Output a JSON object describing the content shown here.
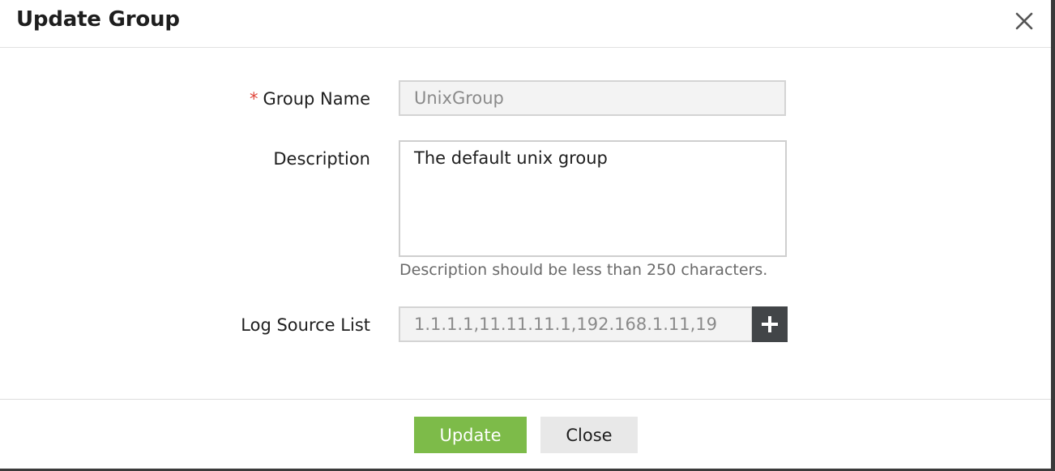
{
  "dialog": {
    "title": "Update Group",
    "close_icon": "close-icon"
  },
  "form": {
    "group_name": {
      "label": "Group Name",
      "required_marker": "*",
      "value": "UnixGroup"
    },
    "description": {
      "label": "Description",
      "value": "The default unix group",
      "hint": "Description should be less than 250 characters."
    },
    "log_source_list": {
      "label": "Log Source List",
      "value": "1.1.1.1,11.11.11.1,192.168.1.11,19",
      "add_icon": "plus-icon"
    }
  },
  "footer": {
    "update_label": "Update",
    "close_label": "Close"
  },
  "colors": {
    "primary_button": "#7dbb49",
    "required_star": "#e0453a",
    "add_button": "#424548"
  }
}
